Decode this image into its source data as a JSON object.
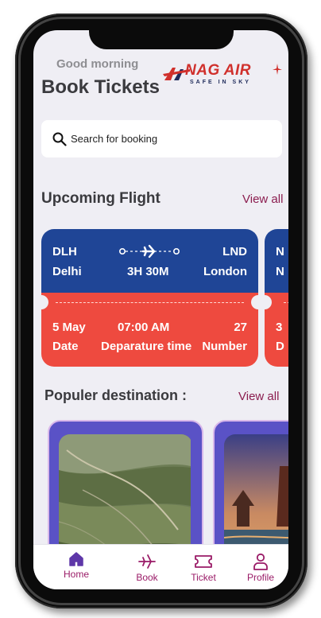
{
  "header": {
    "greeting": "Good morning",
    "title": "Book Tickets",
    "logo_main": "NAG AIR",
    "logo_sub": "SAFE IN SKY"
  },
  "search": {
    "placeholder": "Search for booking"
  },
  "upcoming": {
    "title": "Upcoming Flight",
    "view_all": "View all",
    "flights": [
      {
        "from_code": "DLH",
        "from_city": "Delhi",
        "to_code": "LND",
        "to_city": "London",
        "duration": "3H 30M",
        "date": "5 May",
        "date_label": "Date",
        "time": "07:00 AM",
        "time_label": "Deparature time",
        "number": "27",
        "number_label": "Number"
      },
      {
        "from_code": "N",
        "from_city": "N",
        "date": "3",
        "date_label": "D"
      }
    ]
  },
  "popular": {
    "title": "Populer destination :",
    "view_all": "View all"
  },
  "nav": {
    "items": [
      {
        "label": "Home"
      },
      {
        "label": "Book"
      },
      {
        "label": "Ticket"
      },
      {
        "label": "Profile"
      }
    ]
  },
  "colors": {
    "card_top": "#1f4596",
    "card_bottom": "#ee4a3f",
    "accent": "#9a1b67",
    "dest_card": "#5a52c6"
  }
}
